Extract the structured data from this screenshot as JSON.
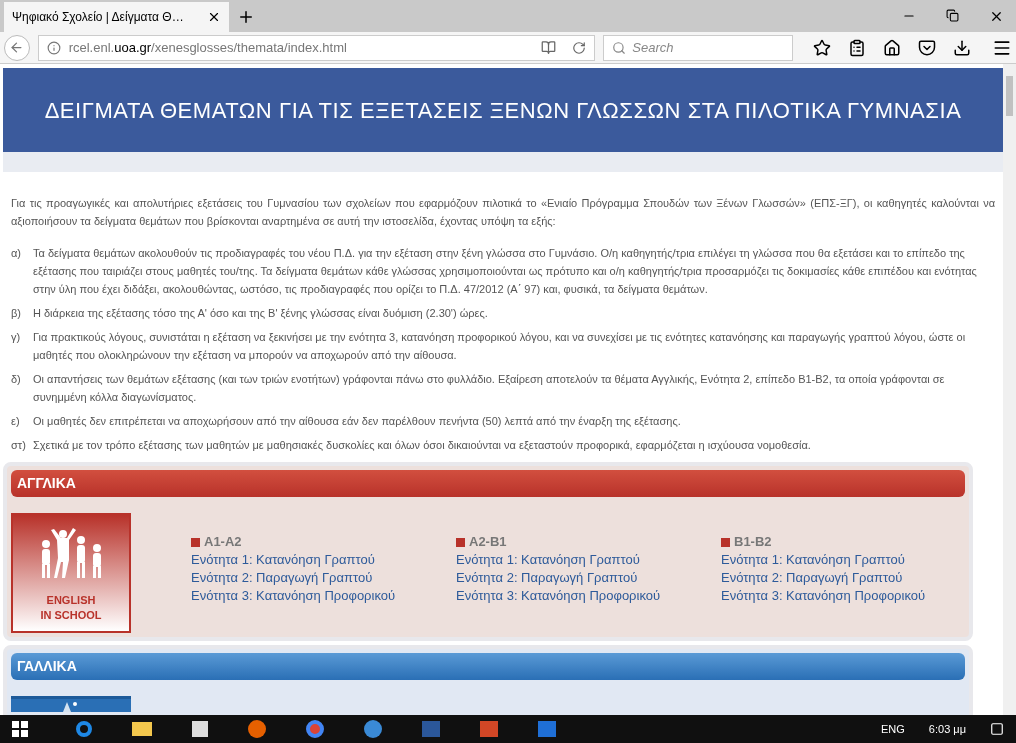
{
  "browser": {
    "tab": {
      "title": "Ψηφιακό Σχολείο | Δείγματα Θ…",
      "selected": true
    },
    "url": {
      "host_prefix": "rcel.enl.",
      "host_domain": "uoa.gr",
      "path": "/xenesglosses/themata/index.html"
    },
    "search": {
      "placeholder": "Search"
    }
  },
  "page": {
    "title": "ΔΕΙΓΜΑΤΑ ΘΕΜΑΤΩΝ ΓΙΑ ΤΙΣ ΕΞΕΤΑΣΕΙΣ ΞΕΝΩΝ ΓΛΩΣΣΩΝ ΣΤΑ ΠΙΛΟΤΙΚΑ ΓΥΜΝΑΣΙΑ",
    "intro": "Για τις προαγωγικές και απολυτήριες εξετάσεις του Γυμνασίου των σχολείων που εφαρμόζουν πιλοτικά το «Ενιαίο Πρόγραμμα Σπουδών των Ξένων Γλωσσών» (ΕΠΣ-ΞΓ), οι καθηγητές καλούνται να αξιοποιήσουν τα δείγματα θεμάτων που βρίσκονται αναρτημένα σε αυτή την ιστοσελίδα, έχοντας υπόψη τα εξής:",
    "items": [
      {
        "marker": "α)",
        "text": "Τα δείγματα θεμάτων ακολουθούν τις προδιαγραφές του νέου Π.Δ. για την εξέταση στην ξένη γλώσσα στο Γυμνάσιο. Ο/η καθηγητής/τρια επιλέγει τη γλώσσα που θα εξετάσει και το επίπεδο της εξέτασης που ταιριάζει στους μαθητές του/της. Τα δείγματα θεμάτων κάθε γλώσσας χρησιμοποιούνται ως πρότυπο και ο/η καθηγητής/τρια προσαρμόζει τις δοκιμασίες κάθε επιπέδου και ενότητας στην ύλη που έχει διδάξει, ακολουθώντας, ωστόσο, τις προδιαγραφές που ορίζει το Π.Δ. 47/2012 (Α΄ 97) και, φυσικά, τα δείγματα θεμάτων."
      },
      {
        "marker": "β)",
        "text": "Η διάρκεια της εξέτασης τόσο της Α' όσο και της Β' ξένης γλώσσας είναι δυόμιση (2.30') ώρες."
      },
      {
        "marker": "γ)",
        "text": "Για πρακτικούς λόγους, συνιστάται η εξέταση να ξεκινήσει με την ενότητα 3, κατανόηση προφορικού λόγου, και να συνεχίσει με τις ενότητες κατανόησης και παραγωγής γραπτού λόγου, ώστε οι μαθητές που ολοκληρώνουν την εξέταση να μπορούν να αποχωρούν από την αίθουσα."
      },
      {
        "marker": "δ)",
        "text": "Οι απαντήσεις των θεμάτων εξέτασης (και των τριών ενοτήτων) γράφονται πάνω στο φυλλάδιο. Εξαίρεση αποτελούν τα θέματα Αγγλικής, Ενότητα 2, επίπεδο Β1-Β2, τα οποία γράφονται σε συνημμένη κόλλα διαγωνίσματος."
      },
      {
        "marker": "ε)",
        "text": "Οι μαθητές δεν επιτρέπεται να αποχωρήσουν από την αίθουσα εάν δεν παρέλθουν πενήντα (50) λεπτά από την έναρξη της εξέτασης."
      },
      {
        "marker": "στ)",
        "text": "Σχετικά με τον τρόπο εξέτασης των μαθητών με μαθησιακές δυσκολίες και όλων όσοι δικαιούνται να εξεταστούν προφορικά, εφαρμόζεται η ισχύουσα νομοθεσία."
      }
    ],
    "languages": [
      {
        "name": "ΑΓΓΛΙΚΑ",
        "color": "#b8322a",
        "logo_text": [
          "ENGLISH",
          "IN SCHOOL"
        ],
        "levels": [
          {
            "name": "A1-A2",
            "units": [
              "Ενότητα 1: Κατανόηση Γραπτού",
              "Ενότητα 2: Παραγωγή Γραπτού",
              "Ενότητα 3: Κατανόηση Προφορικού"
            ]
          },
          {
            "name": "A2-B1",
            "units": [
              "Ενότητα 1: Κατανόηση Γραπτού",
              "Ενότητα 2: Παραγωγή Γραπτού",
              "Ενότητα 3: Κατανόηση Προφορικού"
            ]
          },
          {
            "name": "B1-B2",
            "units": [
              "Ενότητα 1: Κατανόηση Γραπτού",
              "Ενότητα 2: Παραγωγή Γραπτού",
              "Ενότητα 3: Κατανόηση Προφορικού"
            ]
          }
        ]
      },
      {
        "name": "ΓΑΛΛΙΚΑ",
        "color": "#2a6fb5"
      }
    ]
  },
  "taskbar": {
    "language": "ENG",
    "time": "6:03 μμ"
  }
}
